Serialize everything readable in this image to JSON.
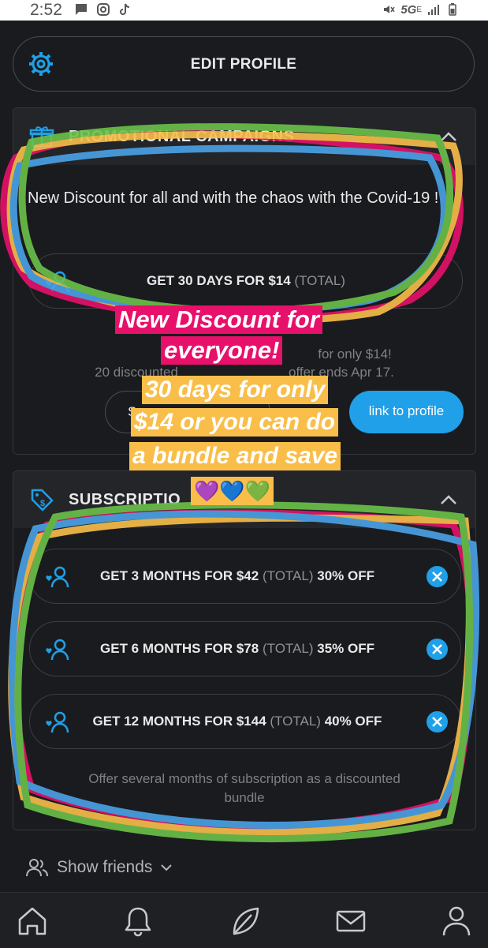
{
  "status_bar": {
    "time": "2:52",
    "network": "5G",
    "network_sub": "E"
  },
  "header": {
    "edit_profile_label": "EDIT PROFILE"
  },
  "promo": {
    "title": "PROMOTIONAL CAMPAIGNS",
    "text": "New Discount for all and with the chaos with the Covid-19 !",
    "offer_main": "GET 30 DAYS FOR $14",
    "offer_suffix": "(TOTAL)",
    "note_line1": "for only $14!",
    "note_line2a": "20 discounted",
    "note_line2b": "offer ends Apr 17.",
    "outline_button_label": "S",
    "primary_button_label": "link to profile"
  },
  "subscription": {
    "title": "SUBSCRIPTIO",
    "bundles": [
      {
        "main": "GET 3 MONTHS FOR $42",
        "suffix": "(TOTAL)",
        "discount": "30% OFF"
      },
      {
        "main": "GET 6 MONTHS FOR $78",
        "suffix": "(TOTAL)",
        "discount": "35% OFF"
      },
      {
        "main": "GET 12 MONTHS FOR $144",
        "suffix": "(TOTAL)",
        "discount": "40% OFF"
      }
    ],
    "note_line1": "Offer several months of subscription as a discounted",
    "note_line2": "bundle"
  },
  "footer": {
    "show_friends_label": "Show friends"
  },
  "overlay_captions": {
    "line1": "New Discount for",
    "line2": "everyone!",
    "line3": "30 days for only",
    "line4": "$14 or you can do",
    "line5": "a bundle and save",
    "hearts": "💜💙💚"
  },
  "colors": {
    "accent": "#1fa0e8",
    "background": "#1a1b1e",
    "caption_pink": "#e7106a",
    "caption_yellow": "#f9be4a"
  },
  "icons": [
    "gear-icon",
    "gift-icon",
    "price-tag-icon",
    "user-heart-icon",
    "close-icon",
    "chevron-up-icon",
    "home-icon",
    "bell-icon",
    "leaf-icon",
    "mail-icon",
    "person-icon",
    "friends-icon"
  ]
}
